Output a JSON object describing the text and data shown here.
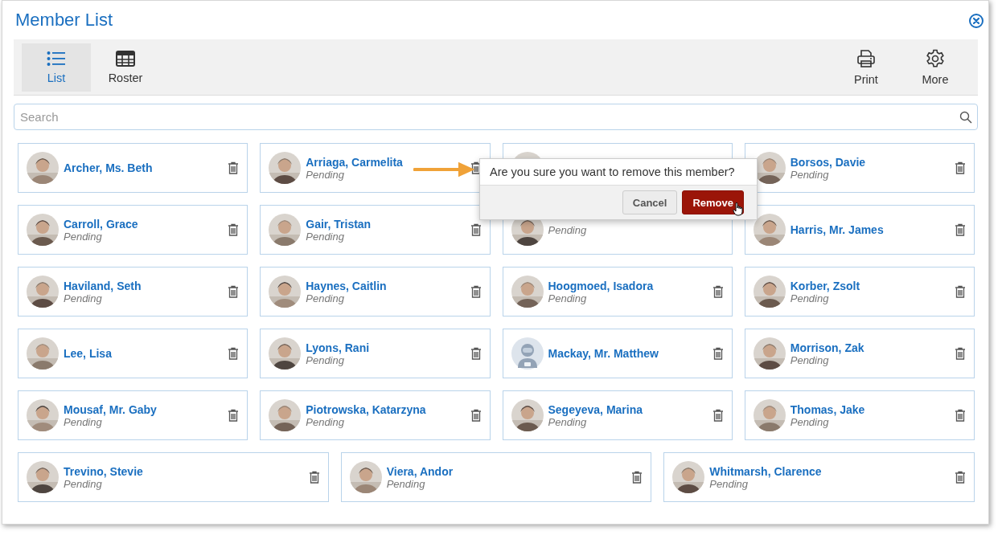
{
  "window": {
    "title": "Member List"
  },
  "toolbar": {
    "left": [
      {
        "label": "List",
        "selected": true
      },
      {
        "label": "Roster",
        "selected": false
      }
    ],
    "right": [
      {
        "label": "Print",
        "selected": false
      },
      {
        "label": "More",
        "selected": false
      }
    ]
  },
  "search": {
    "placeholder": "Search"
  },
  "members": [
    {
      "name": "Archer, Ms. Beth",
      "kind": "picture"
    },
    {
      "name": "Arriaga, Carmelita",
      "status": "Pending",
      "kind": "picture"
    },
    {
      "kind": "picture"
    },
    {
      "name": "Borsos, Davie",
      "status": "Pending",
      "kind": "picture"
    },
    {
      "name": "Carroll, Grace",
      "status": "Pending",
      "kind": "picture"
    },
    {
      "name": "Gair, Tristan",
      "status": "Pending",
      "kind": "picture"
    },
    {
      "status": "Pending",
      "kind": "picture"
    },
    {
      "name": "Harris, Mr. James",
      "kind": "picture"
    },
    {
      "name": "Haviland, Seth",
      "status": "Pending",
      "kind": "picture"
    },
    {
      "name": "Haynes, Caitlin",
      "status": "Pending",
      "kind": "picture"
    },
    {
      "name": "Hoogmoed, Isadora",
      "status": "Pending",
      "kind": "picture"
    },
    {
      "name": "Korber, Zsolt",
      "status": "Pending",
      "kind": "picture"
    },
    {
      "name": "Lee, Lisa",
      "kind": "picture"
    },
    {
      "name": "Lyons, Rani",
      "status": "Pending",
      "kind": "picture"
    },
    {
      "name": "Mackay, Mr. Matthew",
      "kind": "placeholder"
    },
    {
      "name": "Morrison, Zak",
      "status": "Pending",
      "kind": "picture"
    },
    {
      "name": "Mousaf, Mr. Gaby",
      "status": "Pending",
      "kind": "picture"
    },
    {
      "name": "Piotrowska, Katarzyna",
      "status": "Pending",
      "kind": "picture"
    },
    {
      "name": "Segeyeva, Marina",
      "status": "Pending",
      "kind": "picture"
    },
    {
      "name": "Thomas, Jake",
      "status": "Pending",
      "kind": "picture"
    },
    {
      "name": "Trevino, Stevie",
      "status": "Pending",
      "kind": "picture"
    },
    {
      "name": "Viera, Andor",
      "status": "Pending",
      "kind": "picture"
    },
    {
      "name": "Whitmarsh, Clarence",
      "status": "Pending",
      "kind": "picture"
    }
  ],
  "confirm": {
    "message": "Are you sure you want to remove this member?",
    "buttons": [
      {
        "label": "Cancel",
        "kind": "secondary"
      },
      {
        "label": "Remove",
        "kind": "danger"
      }
    ]
  }
}
